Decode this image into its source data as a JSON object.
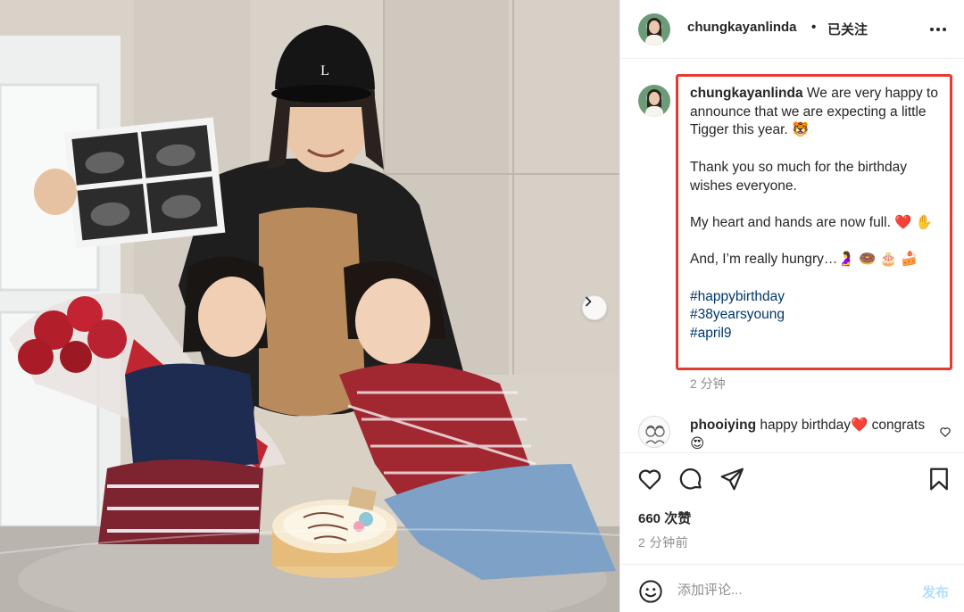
{
  "post": {
    "username": "chungkayanlinda",
    "separator": "•",
    "follow_state": "已关注",
    "more_icon": "more-horizontal-icon",
    "next_icon": "chevron-right-icon"
  },
  "caption": {
    "username": "chungkayanlinda",
    "line1": " We are very happy to announce that we are expecting a little Tigger this year. 🐯",
    "line2": "Thank you so much for the birthday wishes everyone.",
    "line3": "My heart and hands are now full. ❤️ ✋",
    "line4": "And, I’m really hungry…🤰 🍩 🎂 🍰",
    "hashtags": [
      "#happybirthday",
      "#38yearsyoung",
      "#april9"
    ],
    "time": "2 分钟",
    "highlight_color": "#e53b2f"
  },
  "comment": {
    "username": "phooiying",
    "text": " happy birthday❤️ congrats😍",
    "like_icon": "heart-outline-icon"
  },
  "actions": {
    "like_icon": "heart-icon",
    "comment_icon": "speech-bubble-icon",
    "share_icon": "paper-plane-icon",
    "save_icon": "bookmark-icon",
    "likes": "660 次赞",
    "time_ago": "2 分钟前"
  },
  "composer": {
    "emoji_icon": "smiley-icon",
    "placeholder": "添加评论...",
    "post_label": "发布"
  },
  "photo": {
    "cap_logo": "L"
  }
}
